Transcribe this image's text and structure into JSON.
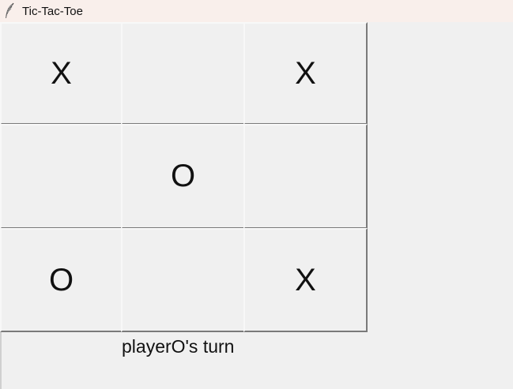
{
  "window": {
    "title": "Tic-Tac-Toe",
    "icon": "feather-icon"
  },
  "board": {
    "cells": [
      [
        "X",
        "",
        "X"
      ],
      [
        "",
        "O",
        ""
      ],
      [
        "O",
        "",
        "X"
      ]
    ]
  },
  "status": {
    "text": "playerO's turn"
  }
}
